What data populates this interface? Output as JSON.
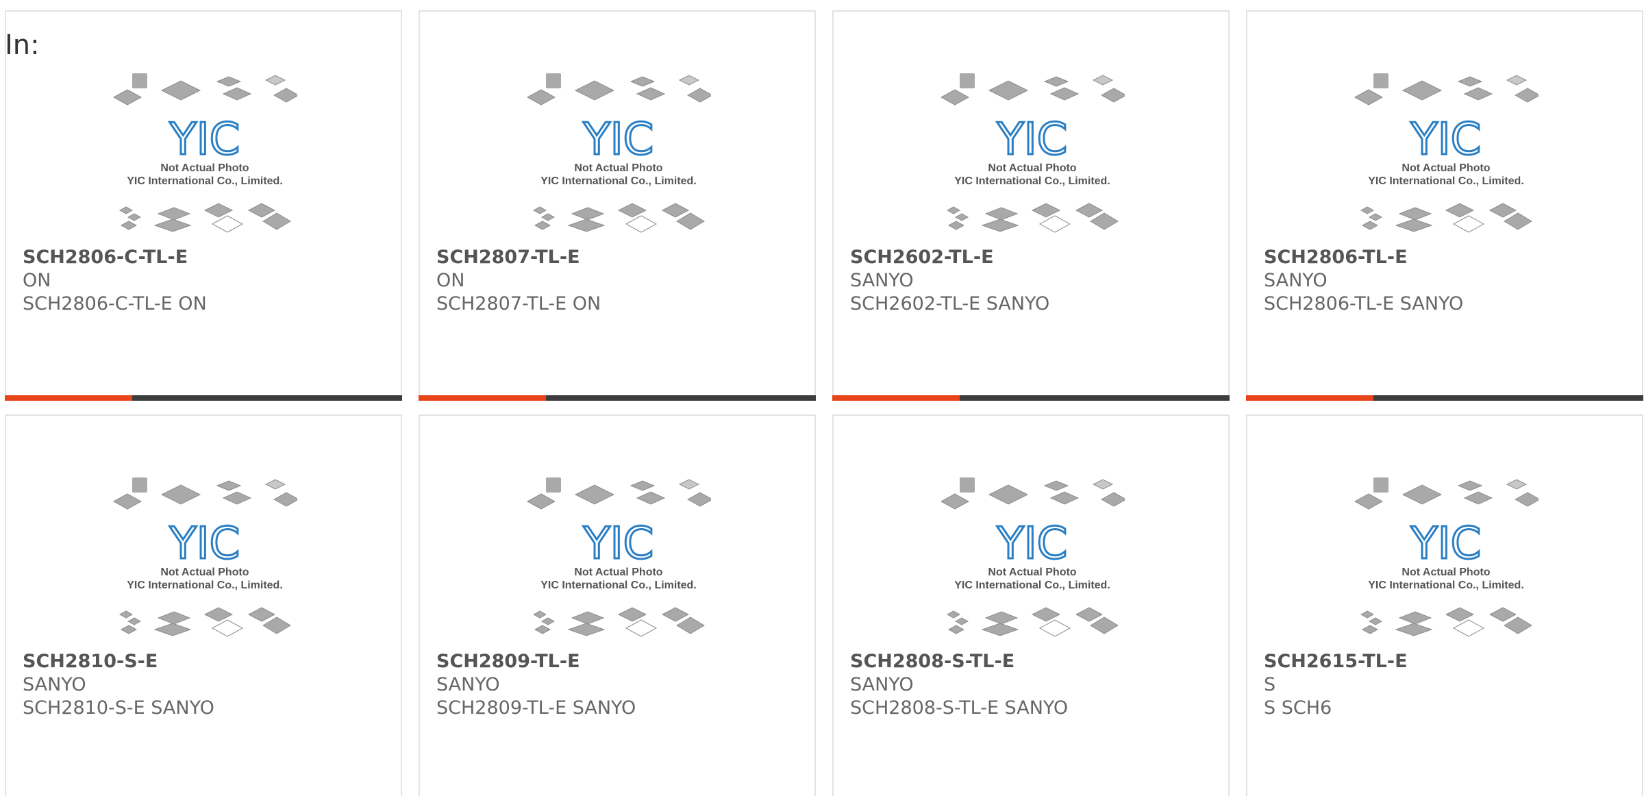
{
  "header": {
    "in_label": "In:"
  },
  "thumbnail": {
    "caption_line1": "Not Actual Photo",
    "caption_line2": "YIC International Co., Limited.",
    "logo_text": "YIC",
    "logo_color": "#2a7fc4"
  },
  "colors": {
    "accent": "#e8441a",
    "bar": "#3c3c3c"
  },
  "products": [
    {
      "part": "SCH2806-C-TL-E",
      "brand": "ON",
      "desc": "SCH2806-C-TL-E ON"
    },
    {
      "part": "SCH2807-TL-E",
      "brand": "ON",
      "desc": "SCH2807-TL-E ON"
    },
    {
      "part": "SCH2602-TL-E",
      "brand": "SANYO",
      "desc": "SCH2602-TL-E SANYO"
    },
    {
      "part": "SCH2806-TL-E",
      "brand": "SANYO",
      "desc": "SCH2806-TL-E SANYO"
    },
    {
      "part": "SCH2810-S-E",
      "brand": "SANYO",
      "desc": "SCH2810-S-E SANYO"
    },
    {
      "part": "SCH2809-TL-E",
      "brand": "SANYO",
      "desc": "SCH2809-TL-E SANYO"
    },
    {
      "part": "SCH2808-S-TL-E",
      "brand": "SANYO",
      "desc": "SCH2808-S-TL-E SANYO"
    },
    {
      "part": "SCH2615-TL-E",
      "brand": "S",
      "desc": "S SCH6"
    }
  ]
}
